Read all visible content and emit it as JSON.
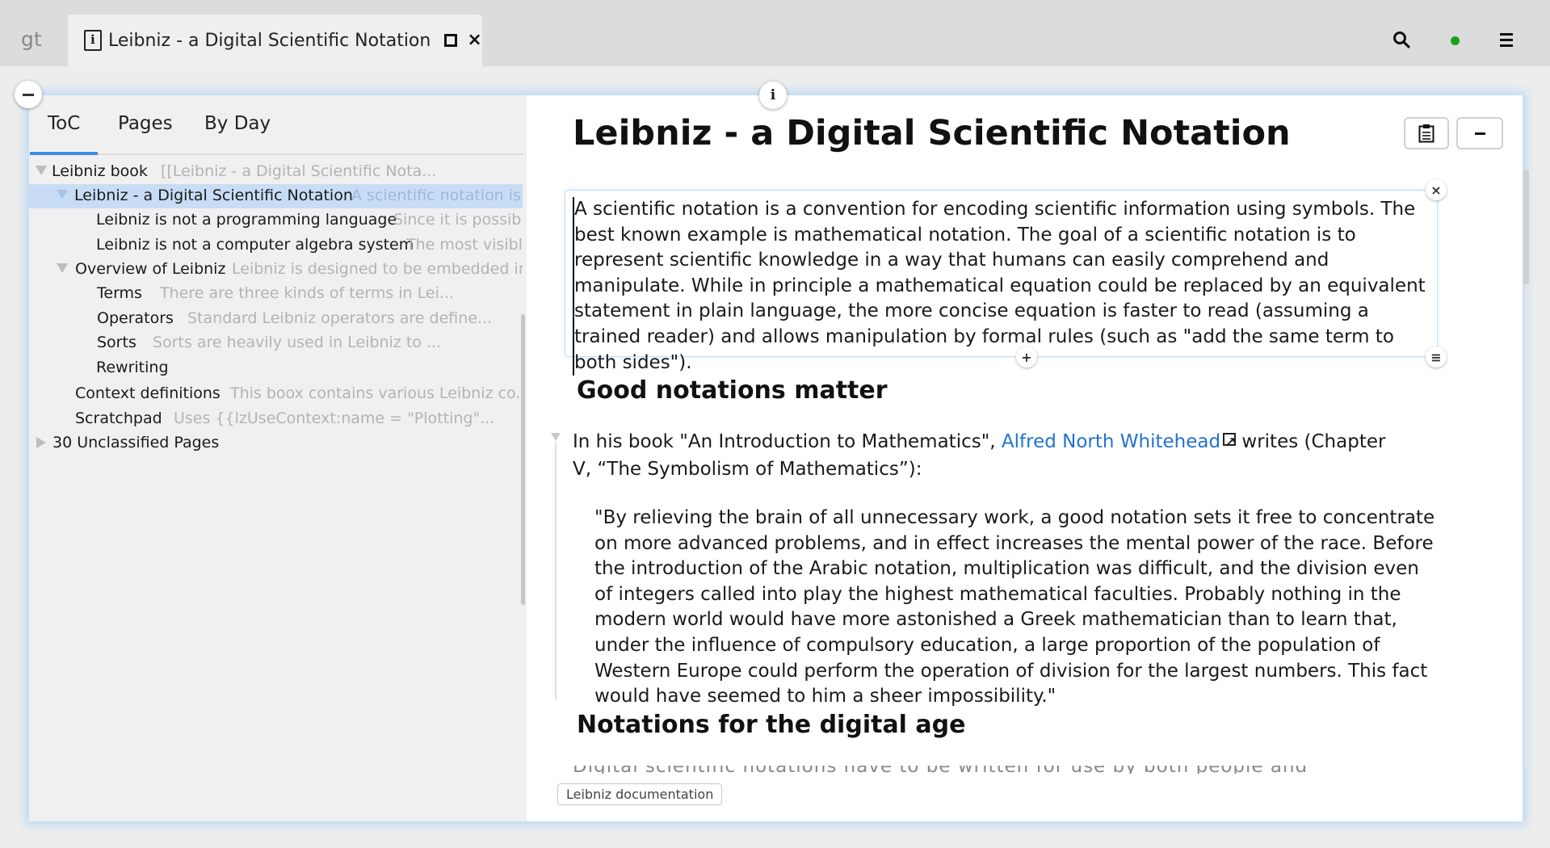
{
  "topbar": {
    "logo": "gt",
    "tab_title": "Leibniz - a Digital Scientific Notation",
    "status_color": "#19a11d"
  },
  "sidebar": {
    "tabs": [
      {
        "label": "ToC",
        "active": true
      },
      {
        "label": "Pages",
        "active": false
      },
      {
        "label": "By Day",
        "active": false
      }
    ],
    "tree": [
      {
        "name": "Leibniz book",
        "preview": "[[Leibniz - a Digital Scientific Nota..."
      },
      {
        "name": "Leibniz - a Digital Scientific Notation",
        "preview": "A scientific notation is a"
      },
      {
        "name": "Leibniz is not a programming language",
        "preview": "Since it is possible"
      },
      {
        "name": "Leibniz is not a computer algebra system",
        "preview": "The most visible"
      },
      {
        "name": "Overview of Leibniz",
        "preview": "Leibniz is designed to be embedded in..."
      },
      {
        "name": "Terms",
        "preview": "There are three kinds of terms in Lei..."
      },
      {
        "name": "Operators",
        "preview": "Standard Leibniz operators are define..."
      },
      {
        "name": "Sorts",
        "preview": "Sorts are heavily used in Leibniz to ..."
      },
      {
        "name": "Rewriting",
        "preview": ""
      },
      {
        "name": "Context definitions",
        "preview": "This boox contains various Leibniz co..."
      },
      {
        "name": "Scratchpad",
        "preview": "Uses {{lzUseContext:name = \"Plotting\"..."
      },
      {
        "name": "30 Unclassified Pages",
        "preview": ""
      }
    ]
  },
  "page": {
    "title": "Leibniz - a Digital Scientific Notation",
    "intro": "A scientific notation is a convention for encoding scientific information using symbols. The best known example is mathematical notation. The goal of a scientific notation is to represent scientific knowledge in a way that humans can easily comprehend and manipulate. While in principle a mathematical equation could be replaced by an equivalent statement in plain language, the more concise equation is faster to read (assuming a trained reader) and allows manipulation by formal rules (such as \"add the same term to both sides\").",
    "heading1": "Good notations matter",
    "para1_before": "In his book \"An Introduction to Mathematics\", ",
    "para1_link": "Alfred North Whitehead",
    "para1_after": " writes (Chapter V, “The Symbolism of Mathematics”):",
    "quote": "\"By relieving the brain of all unnecessary work, a good notation sets it free to concentrate on more advanced problems, and in effect increases the mental power of the race. Before the introduction of the Arabic notation, multiplication was difficult, and the division even of integers called into play the highest mathematical faculties. Probably nothing in the modern world would have more astonished a Greek mathematician than to learn that, under the influence of compulsory education, a large proportion of the population of Western Europe could perform the operation of  division for the largest numbers. This fact would have seemed to him a sheer impossibility.\"",
    "heading2": "Notations for the digital age",
    "cut_text": "Digital scientific notations have to be written for use by both people and computers and both of them need",
    "footer_link": "Leibniz documentation"
  }
}
